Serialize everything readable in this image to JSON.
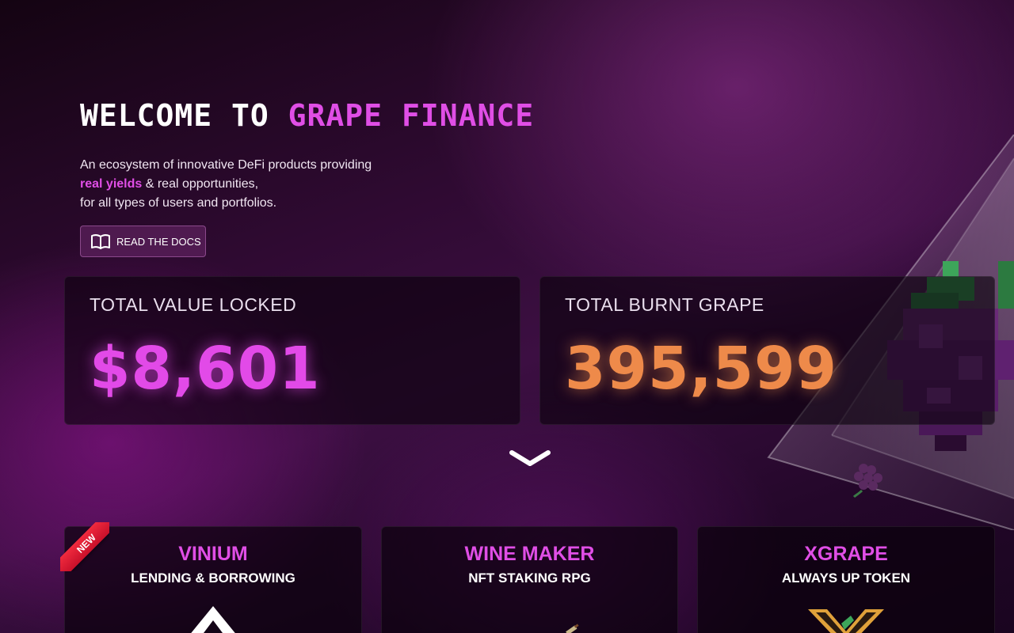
{
  "hero": {
    "title_prefix": "Welcome to",
    "title_highlight": "Grape Finance",
    "desc_line1": "An ecosystem of innovative DeFi products providing",
    "desc_highlight": "real yields",
    "desc_line2_rest": "& real opportunities,",
    "desc_line3": "for all types of users and portfolios.",
    "docs_button": "Read the docs"
  },
  "stats": {
    "tvl_label": "Total Value Locked",
    "tvl_value": "$8,601",
    "burnt_label": "Total Burnt Grape",
    "burnt_value": "395,599"
  },
  "products": [
    {
      "title": "Vinium",
      "subtitle": "Lending & Borrowing",
      "badge": "NEW"
    },
    {
      "title": "Wine Maker",
      "subtitle": "NFT Staking RPG"
    },
    {
      "title": "xGrape",
      "subtitle": "Always Up Token"
    }
  ],
  "icons": {
    "docs": "book-open-icon",
    "scroll": "chevron-down-icon"
  },
  "colors": {
    "accent_pink": "#e04ee6",
    "accent_orange": "#ee8a4a",
    "ribbon_red": "#e01e34"
  }
}
